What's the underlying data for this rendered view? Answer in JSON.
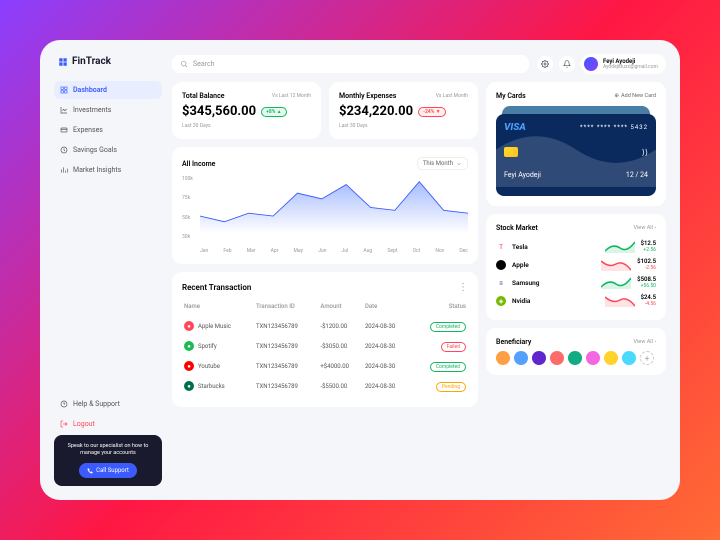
{
  "brand": "FinTrack",
  "search": {
    "placeholder": "Search"
  },
  "profile": {
    "name": "Feyi Ayodeji",
    "email": "AyodejiBuzz@gmail.com"
  },
  "nav": {
    "items": [
      {
        "label": "Dashboard"
      },
      {
        "label": "Investments"
      },
      {
        "label": "Expenses"
      },
      {
        "label": "Savings Goals"
      },
      {
        "label": "Market Insights"
      }
    ],
    "help": "Help & Support",
    "logout": "Logout"
  },
  "support": {
    "text": "Speak to our specialist on how to manage your accounts",
    "btn": "Call Support"
  },
  "stats": {
    "balance": {
      "title": "Total Balance",
      "sub": "Vs Last 12 Month",
      "value": "$345,560.00",
      "badge": "+8% ▲",
      "foot": "Last 30 Days"
    },
    "expenses": {
      "title": "Monthly Expenses",
      "sub": "Vs Last Month",
      "value": "$234,220.00",
      "badge": "-24% ▼",
      "foot": "Last 30 Days"
    }
  },
  "chart": {
    "title": "All Income",
    "filter": "This Month"
  },
  "chart_data": {
    "type": "area",
    "title": "All Income",
    "ylabel": "",
    "ylim": [
      0,
      100
    ],
    "y_ticks": [
      "100k",
      "75k",
      "50k",
      "30k"
    ],
    "categories": [
      "Jan",
      "Feb",
      "Mar",
      "Apr",
      "May",
      "Jun",
      "Jul",
      "Aug",
      "Sept",
      "Oct",
      "Nov",
      "Dec"
    ],
    "values": [
      30,
      20,
      35,
      30,
      70,
      60,
      85,
      45,
      40,
      90,
      40,
      35
    ]
  },
  "transactions": {
    "title": "Recent Transaction",
    "headers": [
      "Name",
      "Transaction ID",
      "Amount",
      "Date",
      "Status"
    ],
    "rows": [
      {
        "name": "Apple Music",
        "icon_bg": "#ff4757",
        "tid": "TXN123456789",
        "amount": "-$1200.00",
        "amt_class": "neg",
        "date": "2024-08-30",
        "status": "Completed",
        "status_class": "completed"
      },
      {
        "name": "Spotify",
        "icon_bg": "#1db954",
        "tid": "TXN123456789",
        "amount": "-$3050.00",
        "amt_class": "neg",
        "date": "2024-08-30",
        "status": "Failed",
        "status_class": "failed"
      },
      {
        "name": "Youtube",
        "icon_bg": "#ff0000",
        "tid": "TXN123456789",
        "amount": "+$4000.00",
        "amt_class": "pos",
        "date": "2024-08-30",
        "status": "Completed",
        "status_class": "completed"
      },
      {
        "name": "Starbucks",
        "icon_bg": "#00704a",
        "tid": "TXN123456789",
        "amount": "-$5500.00",
        "amt_class": "neg",
        "date": "2024-08-30",
        "status": "Pending",
        "status_class": "pending"
      }
    ]
  },
  "mycards": {
    "title": "My Cards",
    "add": "Add New Card"
  },
  "card": {
    "brand": "VISA",
    "num": "**** **** **** 5432",
    "holder": "Feyi Ayodeji",
    "exp": "12 / 24"
  },
  "stocks": {
    "title": "Stock Market",
    "viewall": "View All ›",
    "rows": [
      {
        "name": "Tesla",
        "icon": "T",
        "icon_bg": "#fff",
        "icon_color": "#e82127",
        "price": "$12.5",
        "change": "+2.56",
        "dir": "up",
        "spark_color": "#0fb863"
      },
      {
        "name": "Apple",
        "icon": "",
        "icon_bg": "#000",
        "icon_color": "#fff",
        "price": "$102.5",
        "change": "-2.56",
        "dir": "down",
        "spark_color": "#ff4757"
      },
      {
        "name": "Samsung",
        "icon": "≡",
        "icon_bg": "#fff",
        "icon_color": "#1428a0",
        "price": "$508.5",
        "change": "+56.50",
        "dir": "up",
        "spark_color": "#0fb863"
      },
      {
        "name": "Nvidia",
        "icon": "◈",
        "icon_bg": "#76b900",
        "icon_color": "#fff",
        "price": "$24.5",
        "change": "-4.56",
        "dir": "down",
        "spark_color": "#ff4757"
      }
    ]
  },
  "beneficiary": {
    "title": "Beneficiary",
    "viewall": "View All ›",
    "colors": [
      "#ff9f43",
      "#54a0ff",
      "#5f27cd",
      "#ff6b6b",
      "#10ac84",
      "#f368e0",
      "#ffd32a",
      "#48dbfb"
    ]
  }
}
